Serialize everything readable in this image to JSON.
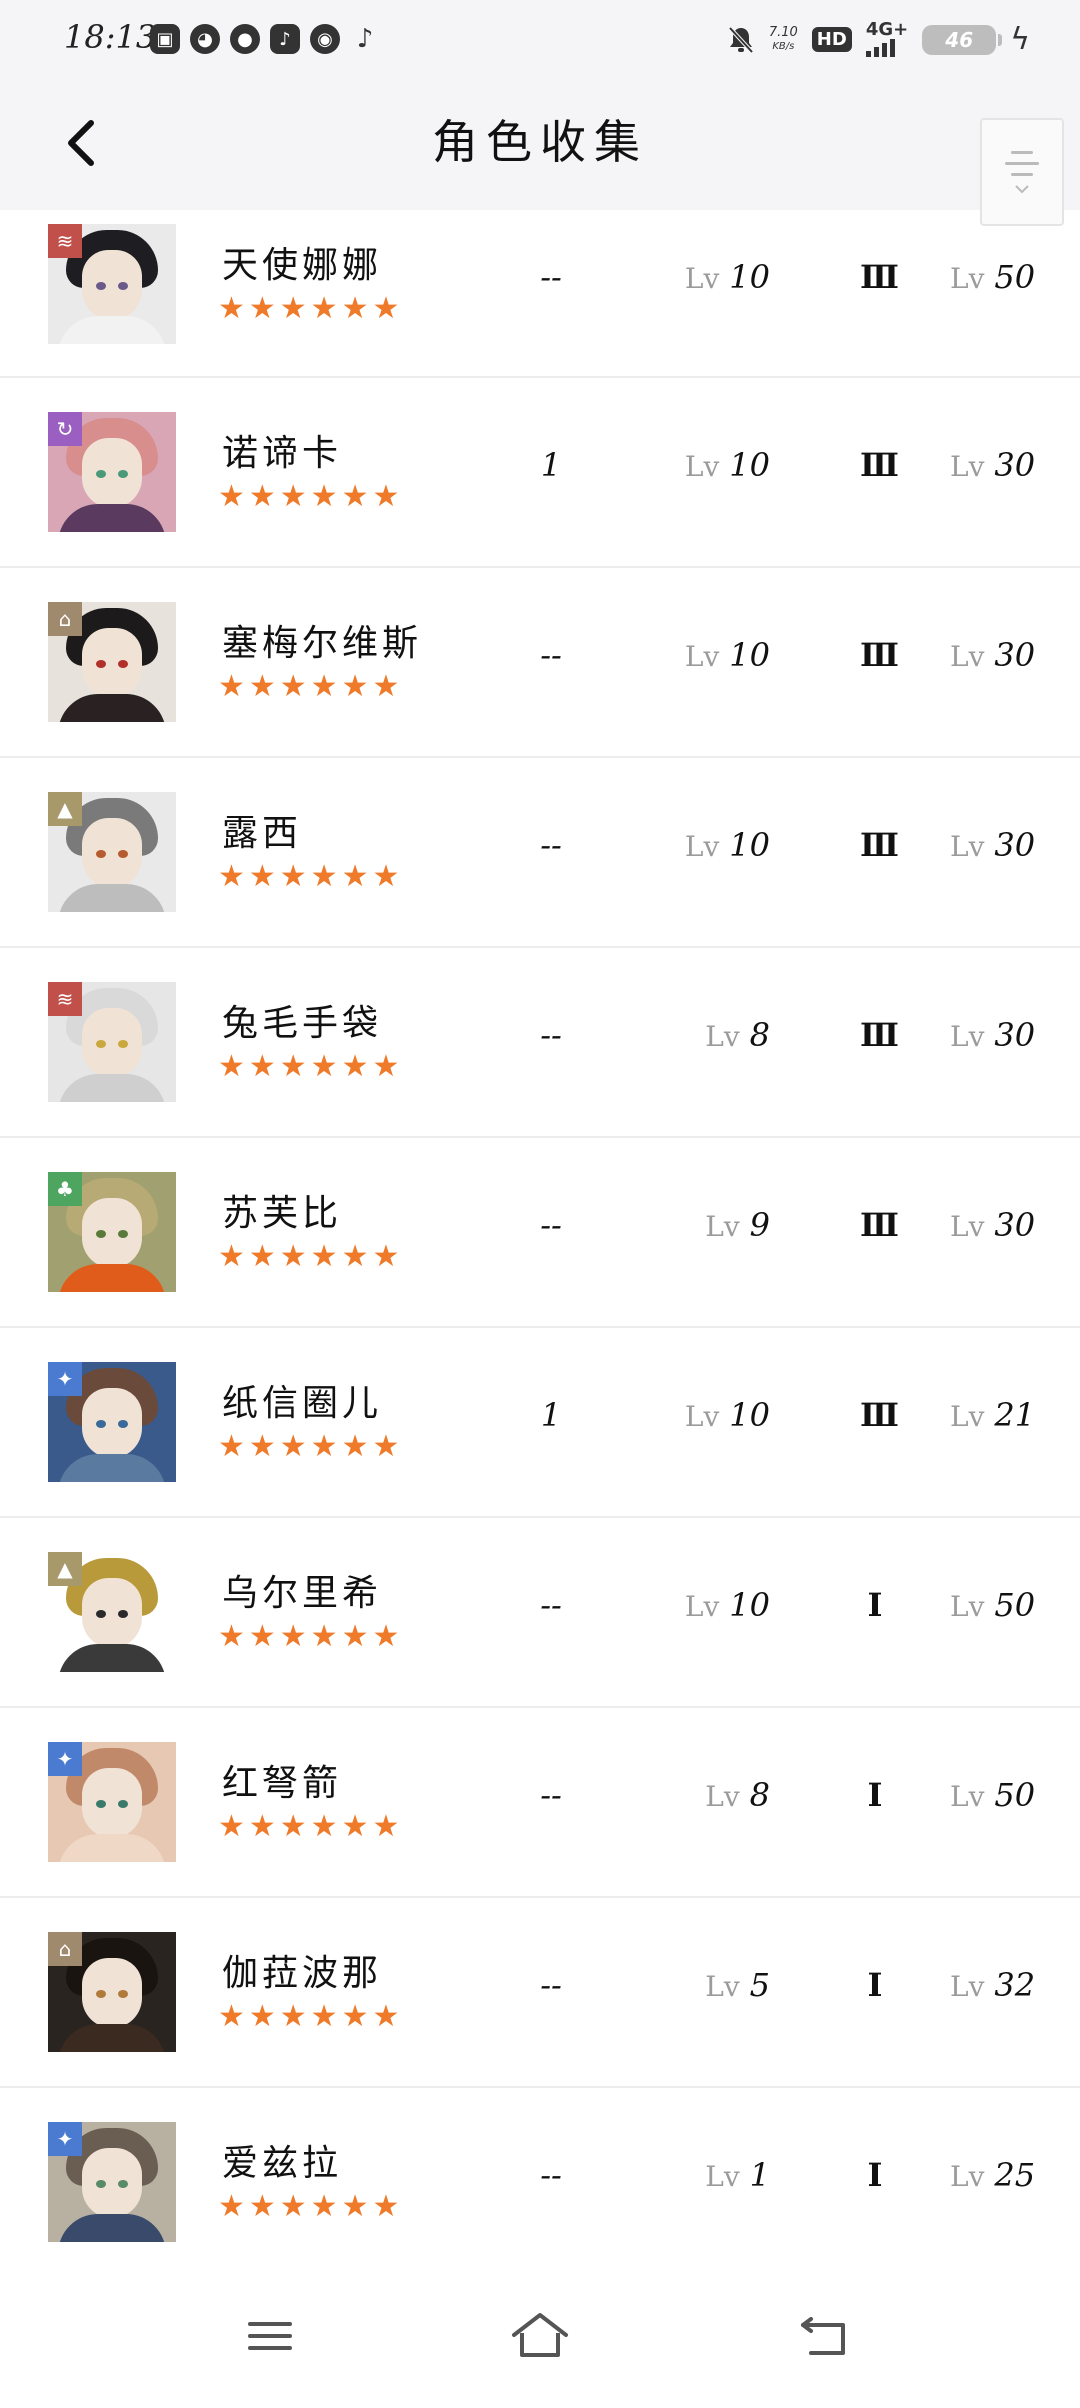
{
  "status_bar": {
    "time": "18:13",
    "net_speed_value": "7.10",
    "net_speed_unit": "KB/s",
    "hd_label": "HD",
    "signal_label": "4G+",
    "battery_level": "46"
  },
  "header": {
    "title": "角色收集"
  },
  "characters": [
    {
      "name": "天使娜娜",
      "stars": "★★★★★★",
      "dup": "--",
      "skill_lv": "10",
      "rank": "Ⅲ",
      "level": "50",
      "badge_color": "#c2504a",
      "badge_icon": "≋"
    },
    {
      "name": "诺谛卡",
      "stars": "★★★★★★",
      "dup": "1",
      "skill_lv": "10",
      "rank": "Ⅲ",
      "level": "30",
      "badge_color": "#9a5fc0",
      "badge_icon": "↻"
    },
    {
      "name": "塞梅尔维斯",
      "stars": "★★★★★★",
      "dup": "--",
      "skill_lv": "10",
      "rank": "Ⅲ",
      "level": "30",
      "badge_color": "#a08a6e",
      "badge_icon": "⌂"
    },
    {
      "name": "露西",
      "stars": "★★★★★★",
      "dup": "--",
      "skill_lv": "10",
      "rank": "Ⅲ",
      "level": "30",
      "badge_color": "#a8996b",
      "badge_icon": "▲"
    },
    {
      "name": "兔毛手袋",
      "stars": "★★★★★★",
      "dup": "--",
      "skill_lv": "8",
      "rank": "Ⅲ",
      "level": "30",
      "badge_color": "#c2504a",
      "badge_icon": "≋"
    },
    {
      "name": "苏芙比",
      "stars": "★★★★★★",
      "dup": "--",
      "skill_lv": "9",
      "rank": "Ⅲ",
      "level": "30",
      "badge_color": "#4ea560",
      "badge_icon": "♣"
    },
    {
      "name": "纸信圈儿",
      "stars": "★★★★★★",
      "dup": "1",
      "skill_lv": "10",
      "rank": "Ⅲ",
      "level": "21",
      "badge_color": "#4a7bd0",
      "badge_icon": "✦"
    },
    {
      "name": "乌尔里希",
      "stars": "★★★★★★",
      "dup": "--",
      "skill_lv": "10",
      "rank": "Ⅰ",
      "level": "50",
      "badge_color": "#a8996b",
      "badge_icon": "▲"
    },
    {
      "name": "红弩箭",
      "stars": "★★★★★★",
      "dup": "--",
      "skill_lv": "8",
      "rank": "Ⅰ",
      "level": "50",
      "badge_color": "#4a7bd0",
      "badge_icon": "✦"
    },
    {
      "name": "伽菈波那",
      "stars": "★★★★★★",
      "dup": "--",
      "skill_lv": "5",
      "rank": "Ⅰ",
      "level": "32",
      "badge_color": "#a08a6e",
      "badge_icon": "⌂"
    },
    {
      "name": "爱兹拉",
      "stars": "★★★★★★",
      "dup": "--",
      "skill_lv": "1",
      "rank": "Ⅰ",
      "level": "25",
      "badge_color": "#4a7bd0",
      "badge_icon": "✦"
    }
  ],
  "lv_prefix": "Lv",
  "accent_star_color": "#ee7a2a"
}
